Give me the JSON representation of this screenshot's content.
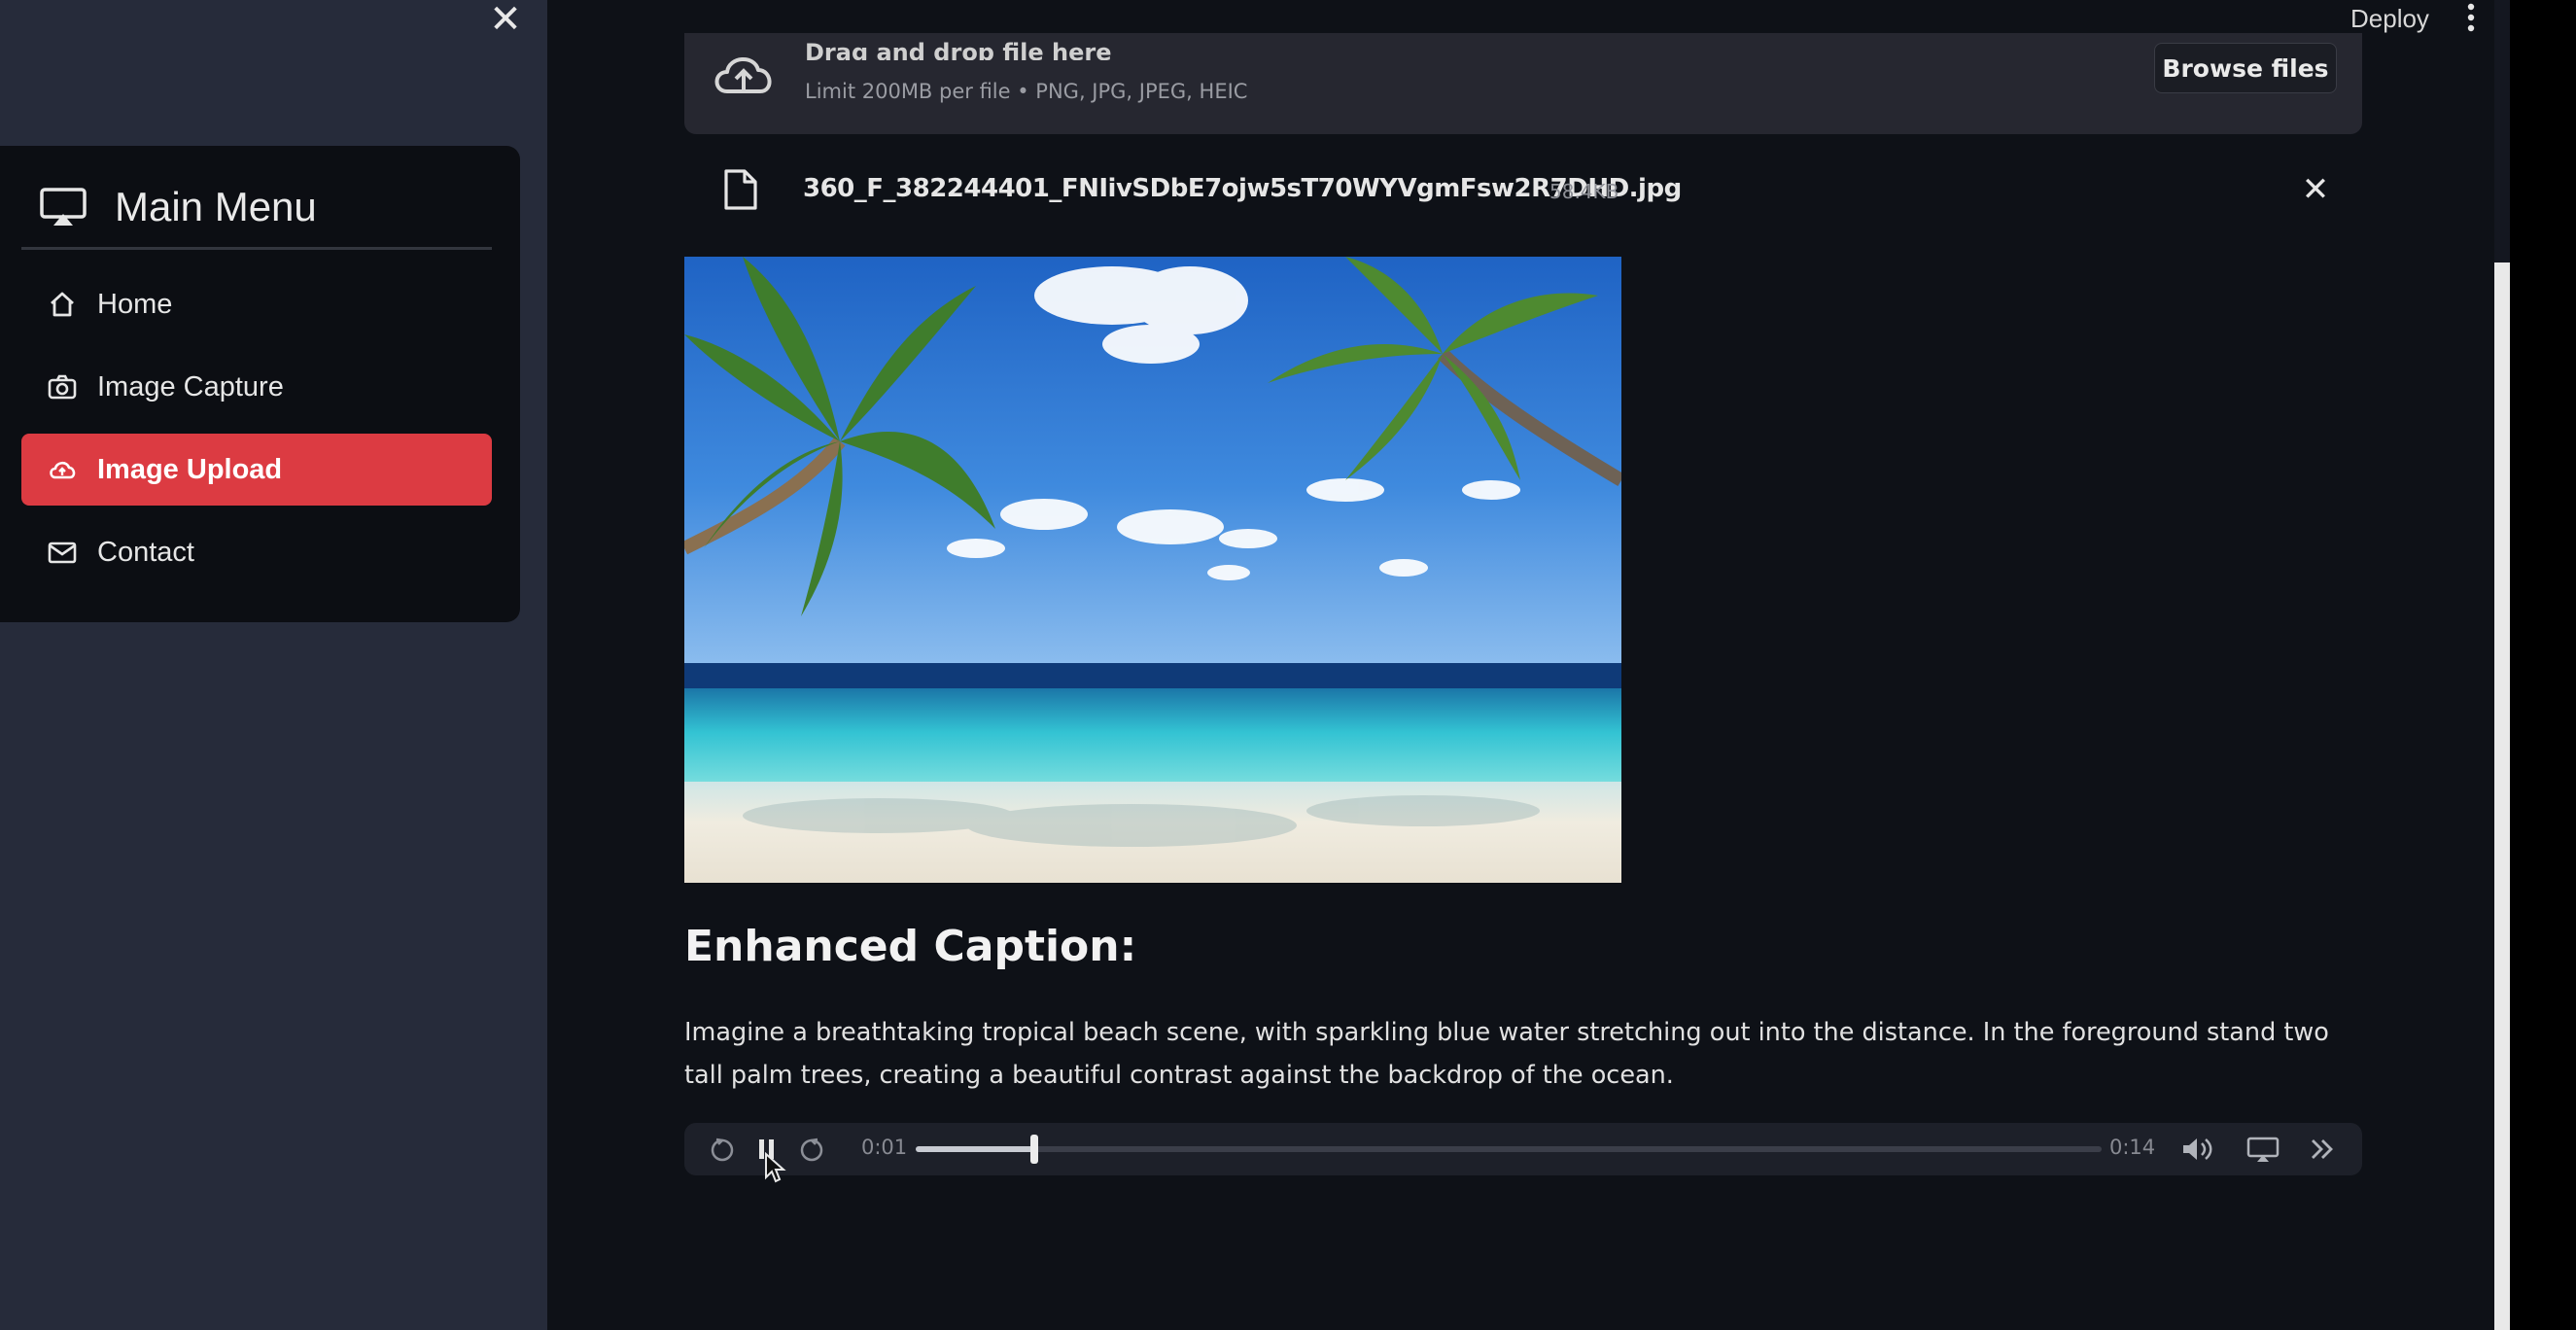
{
  "sidebar": {
    "close_icon": "close-icon",
    "menu_title": "Main Menu",
    "items": [
      {
        "label": "Home",
        "icon": "home-icon"
      },
      {
        "label": "Image Capture",
        "icon": "camera-icon"
      },
      {
        "label": "Image Upload",
        "icon": "cloud-upload-icon",
        "active": true
      },
      {
        "label": "Contact",
        "icon": "envelope-icon"
      }
    ]
  },
  "topbar": {
    "deploy_label": "Deploy"
  },
  "uploader": {
    "drag_text": "Drag and drop file here",
    "limit_text": "Limit 200MB per file • PNG, JPG, JPEG, HEIC",
    "browse_label": "Browse files"
  },
  "file": {
    "name": "360_F_382244401_FNIivSDbE7ojw5sT70WYVgmFsw2R7DHD.jpg",
    "size": "58.4KB"
  },
  "caption": {
    "heading": "Enhanced Caption:",
    "text": "Imagine a breathtaking tropical beach scene, with sparkling blue water stretching out into the distance. In the foreground stand two tall palm trees, creating a beautiful contrast against the backdrop of the ocean."
  },
  "audio": {
    "current_time": "0:01",
    "duration": "0:14",
    "progress": 0.1
  },
  "colors": {
    "accent": "#dc3b42",
    "background": "#0e1117",
    "sidebar": "#262b3a"
  }
}
